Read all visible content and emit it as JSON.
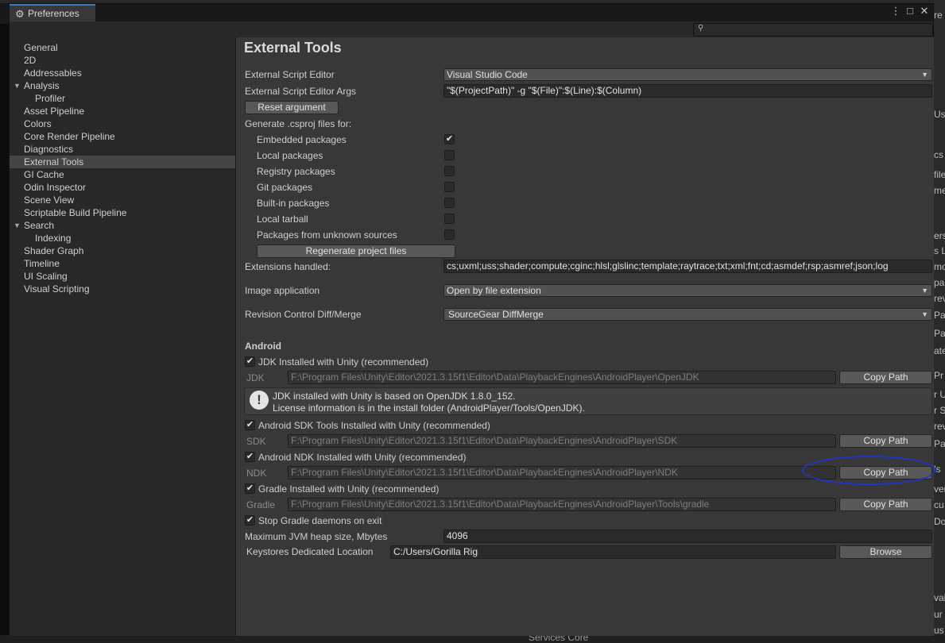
{
  "window": {
    "title": "Preferences",
    "search_placeholder": "",
    "buttons": [
      "⋮",
      "□",
      "✕"
    ]
  },
  "sidebar": {
    "items": [
      {
        "label": "General"
      },
      {
        "label": "2D"
      },
      {
        "label": "Addressables"
      },
      {
        "label": "Analysis",
        "expanded": true
      },
      {
        "label": "Profiler",
        "sub": true
      },
      {
        "label": "Asset Pipeline"
      },
      {
        "label": "Colors"
      },
      {
        "label": "Core Render Pipeline"
      },
      {
        "label": "Diagnostics"
      },
      {
        "label": "External Tools",
        "selected": true
      },
      {
        "label": "GI Cache"
      },
      {
        "label": "Odin Inspector"
      },
      {
        "label": "Scene View"
      },
      {
        "label": "Scriptable Build Pipeline"
      },
      {
        "label": "Search",
        "expanded": true
      },
      {
        "label": "Indexing",
        "sub": true
      },
      {
        "label": "Shader Graph"
      },
      {
        "label": "Timeline"
      },
      {
        "label": "UI Scaling"
      },
      {
        "label": "Visual Scripting"
      }
    ]
  },
  "main": {
    "title": "External Tools",
    "script_editor_label": "External Script Editor",
    "script_editor_value": "Visual Studio Code",
    "script_editor_args_label": "External Script Editor Args",
    "script_editor_args_value": "\"$(ProjectPath)\" -g \"$(File)\":$(Line):$(Column)",
    "reset_argument": "Reset argument",
    "csproj_label": "Generate .csproj files for:",
    "csproj_options": [
      {
        "label": "Embedded packages",
        "checked": true
      },
      {
        "label": "Local packages",
        "checked": false
      },
      {
        "label": "Registry packages",
        "checked": false
      },
      {
        "label": "Git packages",
        "checked": false
      },
      {
        "label": "Built-in packages",
        "checked": false
      },
      {
        "label": "Local tarball",
        "checked": false
      },
      {
        "label": "Packages from unknown sources",
        "checked": false
      }
    ],
    "regenerate": "Regenerate project files",
    "extensions_label": "Extensions handled:",
    "extensions_value": "cs;uxml;uss;shader;compute;cginc;hlsl;glslinc;template;raytrace;txt;xml;fnt;cd;asmdef;rsp;asmref;json;log",
    "image_app_label": "Image application",
    "image_app_value": "Open by file extension",
    "revision_label": "Revision Control Diff/Merge",
    "revision_value": "SourceGear DiffMerge"
  },
  "android": {
    "section_title": "Android",
    "jdk_check_label": "JDK Installed with Unity (recommended)",
    "jdk_label": "JDK",
    "jdk_path": "F:\\Program Files\\Unity\\Editor\\2021.3.15f1\\Editor\\Data\\PlaybackEngines\\AndroidPlayer\\OpenJDK",
    "copy_path": "Copy Path",
    "help_line1": "JDK installed with Unity is based on OpenJDK 1.8.0_152.",
    "help_line2": "License information is in the install folder (AndroidPlayer/Tools/OpenJDK).",
    "sdk_check_label": "Android SDK Tools Installed with Unity (recommended)",
    "sdk_label": "SDK",
    "sdk_path": "F:\\Program Files\\Unity\\Editor\\2021.3.15f1\\Editor\\Data\\PlaybackEngines\\AndroidPlayer\\SDK",
    "ndk_check_label": "Android NDK Installed with Unity (recommended)",
    "ndk_label": "NDK",
    "ndk_path": "F:\\Program Files\\Unity\\Editor\\2021.3.15f1\\Editor\\Data\\PlaybackEngines\\AndroidPlayer\\NDK",
    "gradle_check_label": "Gradle Installed with Unity (recommended)",
    "gradle_label": "Gradle",
    "gradle_path": "F:\\Program Files\\Unity\\Editor\\2021.3.15f1\\Editor\\Data\\PlaybackEngines\\AndroidPlayer\\Tools\\gradle",
    "stop_gradle_label": "Stop Gradle daemons on exit",
    "jvm_heap_label": "Maximum JVM heap size, Mbytes",
    "jvm_heap_value": "4096",
    "keystore_label": "Keystores Dedicated Location",
    "keystore_value": "C:/Users/Gorilla Rig",
    "browse": "Browse"
  },
  "background": {
    "right_fragments": [
      "re",
      "Us",
      "cs",
      "file",
      "me",
      "ers",
      "s L",
      "mo",
      "pac",
      "rev",
      "Pa",
      "Pa",
      "ate",
      "Pr",
      "r U",
      "r S",
      "rev",
      "Pa",
      "ls",
      "ver",
      "cu",
      "Dov",
      "val",
      "ur",
      "us"
    ],
    "bottom_fragment": "Services Core"
  }
}
